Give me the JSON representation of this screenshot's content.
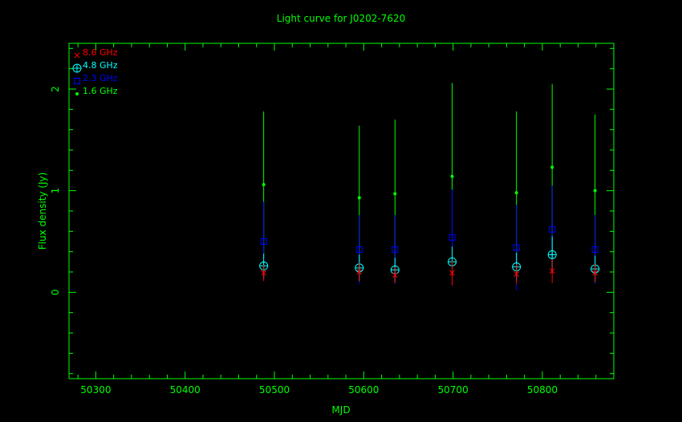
{
  "chart_data": {
    "type": "scatter",
    "title": "Light curve for J0202-7620",
    "xlabel": "MJD",
    "ylabel": "Flux density (Jy)",
    "xlim": [
      50270,
      50880
    ],
    "ylim": [
      -0.85,
      2.45
    ],
    "xticks": [
      50300,
      50400,
      50500,
      50600,
      50700,
      50800
    ],
    "yticks": [
      0,
      1,
      2
    ],
    "grid": false,
    "legend_position": "top-left",
    "colors": {
      "background": "#000000",
      "axes": "#00ff00",
      "title": "#00ff00"
    },
    "series": [
      {
        "name": "8.6 GHz",
        "marker": "cross",
        "color": "#ff0000",
        "points": [
          {
            "x": 50488,
            "y": 0.19,
            "err": 0.08
          },
          {
            "x": 50595,
            "y": 0.2,
            "err": 0.09
          },
          {
            "x": 50635,
            "y": 0.17,
            "err": 0.08
          },
          {
            "x": 50699,
            "y": 0.19,
            "err": 0.12
          },
          {
            "x": 50771,
            "y": 0.18,
            "err": 0.1
          },
          {
            "x": 50811,
            "y": 0.21,
            "err": 0.12
          },
          {
            "x": 50859,
            "y": 0.19,
            "err": 0.09
          }
        ]
      },
      {
        "name": "4.8 GHz",
        "marker": "circle-plus",
        "color": "#00ffff",
        "points": [
          {
            "x": 50488,
            "y": 0.26,
            "err": 0.12
          },
          {
            "x": 50595,
            "y": 0.24,
            "err": 0.13
          },
          {
            "x": 50635,
            "y": 0.22,
            "err": 0.12
          },
          {
            "x": 50699,
            "y": 0.3,
            "err": 0.15
          },
          {
            "x": 50771,
            "y": 0.25,
            "err": 0.14
          },
          {
            "x": 50811,
            "y": 0.37,
            "err": 0.18
          },
          {
            "x": 50859,
            "y": 0.23,
            "err": 0.13
          }
        ]
      },
      {
        "name": "2.3 GHz",
        "marker": "square",
        "color": "#0000ff",
        "points": [
          {
            "x": 50488,
            "y": 0.5,
            "err": 0.39
          },
          {
            "x": 50595,
            "y": 0.42,
            "err": 0.34
          },
          {
            "x": 50635,
            "y": 0.42,
            "err": 0.34
          },
          {
            "x": 50699,
            "y": 0.54,
            "err": 0.47
          },
          {
            "x": 50771,
            "y": 0.44,
            "err": 0.42
          },
          {
            "x": 50811,
            "y": 0.62,
            "err": 0.43
          },
          {
            "x": 50859,
            "y": 0.42,
            "err": 0.34
          }
        ]
      },
      {
        "name": "1.6 GHz",
        "marker": "dot",
        "color": "#00ff00",
        "points": [
          {
            "x": 50488,
            "y": 1.06,
            "err": 0.72
          },
          {
            "x": 50595,
            "y": 0.93,
            "err": 0.71
          },
          {
            "x": 50635,
            "y": 0.97,
            "err": 0.73
          },
          {
            "x": 50699,
            "y": 1.14,
            "err": 0.92
          },
          {
            "x": 50771,
            "y": 0.98,
            "err": 0.8
          },
          {
            "x": 50811,
            "y": 1.23,
            "err": 0.82
          },
          {
            "x": 50859,
            "y": 1.0,
            "err": 0.75
          }
        ]
      }
    ]
  }
}
